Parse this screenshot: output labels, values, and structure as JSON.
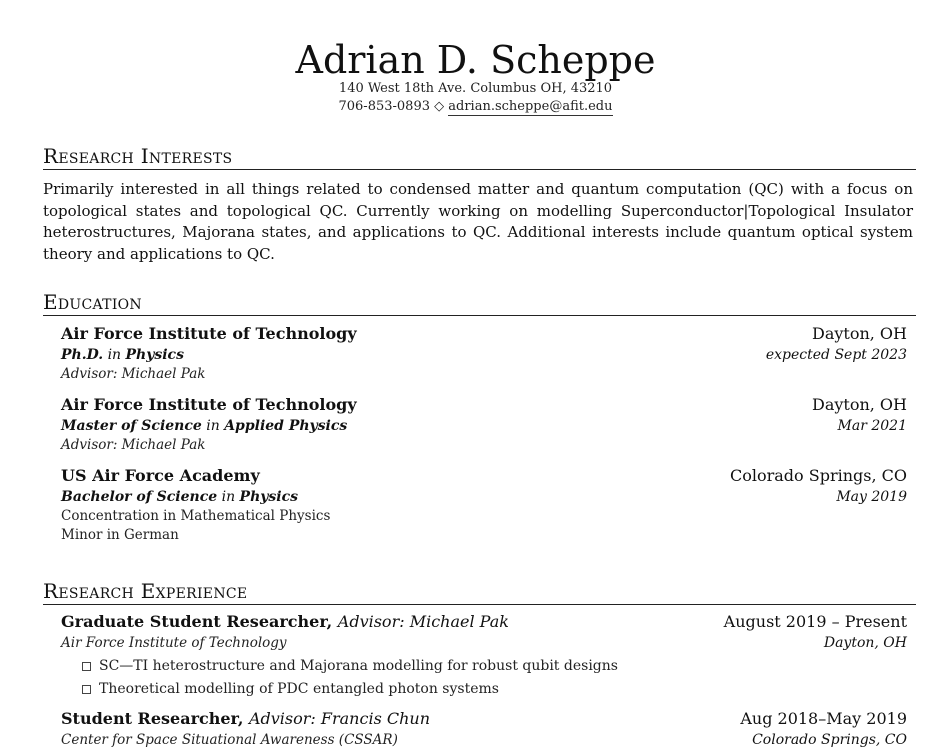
{
  "header": {
    "name": "Adrian D. Scheppe",
    "address": "140 West 18th Ave. Columbus OH, 43210",
    "phone": "706-853-0893",
    "separator": "◇",
    "email": "adrian.scheppe@afit.edu"
  },
  "research_interests": {
    "title": "Research Interests",
    "text": "Primarily interested in all things related to condensed matter and quantum computation (QC) with a focus on topological states and topological QC. Currently working on modelling Superconductor|Topological Insulator heterostructures, Majorana states, and applications to QC. Additional interests include quantum optical system theory and applications to QC."
  },
  "education": {
    "title": "Education",
    "entries": [
      {
        "institution": "Air Force Institute of Technology",
        "location": "Dayton, OH",
        "degree": "Ph.D.",
        "in": "in",
        "field": "Physics",
        "date": "expected Sept 2023",
        "notes": [
          "Advisor: Michael Pak"
        ]
      },
      {
        "institution": "Air Force Institute of Technology",
        "location": "Dayton, OH",
        "degree": "Master of Science",
        "in": "in",
        "field": "Applied Physics",
        "date": "Mar 2021",
        "notes": [
          "Advisor: Michael Pak"
        ]
      },
      {
        "institution": "US Air Force Academy",
        "location": "Colorado Springs, CO",
        "degree": "Bachelor of Science",
        "in": "in",
        "field": "Physics",
        "date": "May 2019",
        "notes": [
          "Concentration in Mathematical Physics",
          "Minor in German"
        ]
      }
    ]
  },
  "research_experience": {
    "title": "Research Experience",
    "entries": [
      {
        "role": "Graduate Student Researcher,",
        "advisor": "Advisor: Michael Pak",
        "dates": "August 2019 – Present",
        "organization": "Air Force Institute of Technology",
        "location": "Dayton, OH",
        "bullets": [
          "SC—TI heterostructure and Majorana modelling for robust qubit designs",
          "Theoretical modelling of PDC entangled photon systems"
        ]
      },
      {
        "role": "Student Researcher,",
        "advisor": "Advisor: Francis Chun",
        "dates": "Aug 2018–May 2019",
        "organization": "Center for Space Situational Awareness (CSSAR)",
        "location": "Colorado Springs, CO"
      }
    ]
  }
}
